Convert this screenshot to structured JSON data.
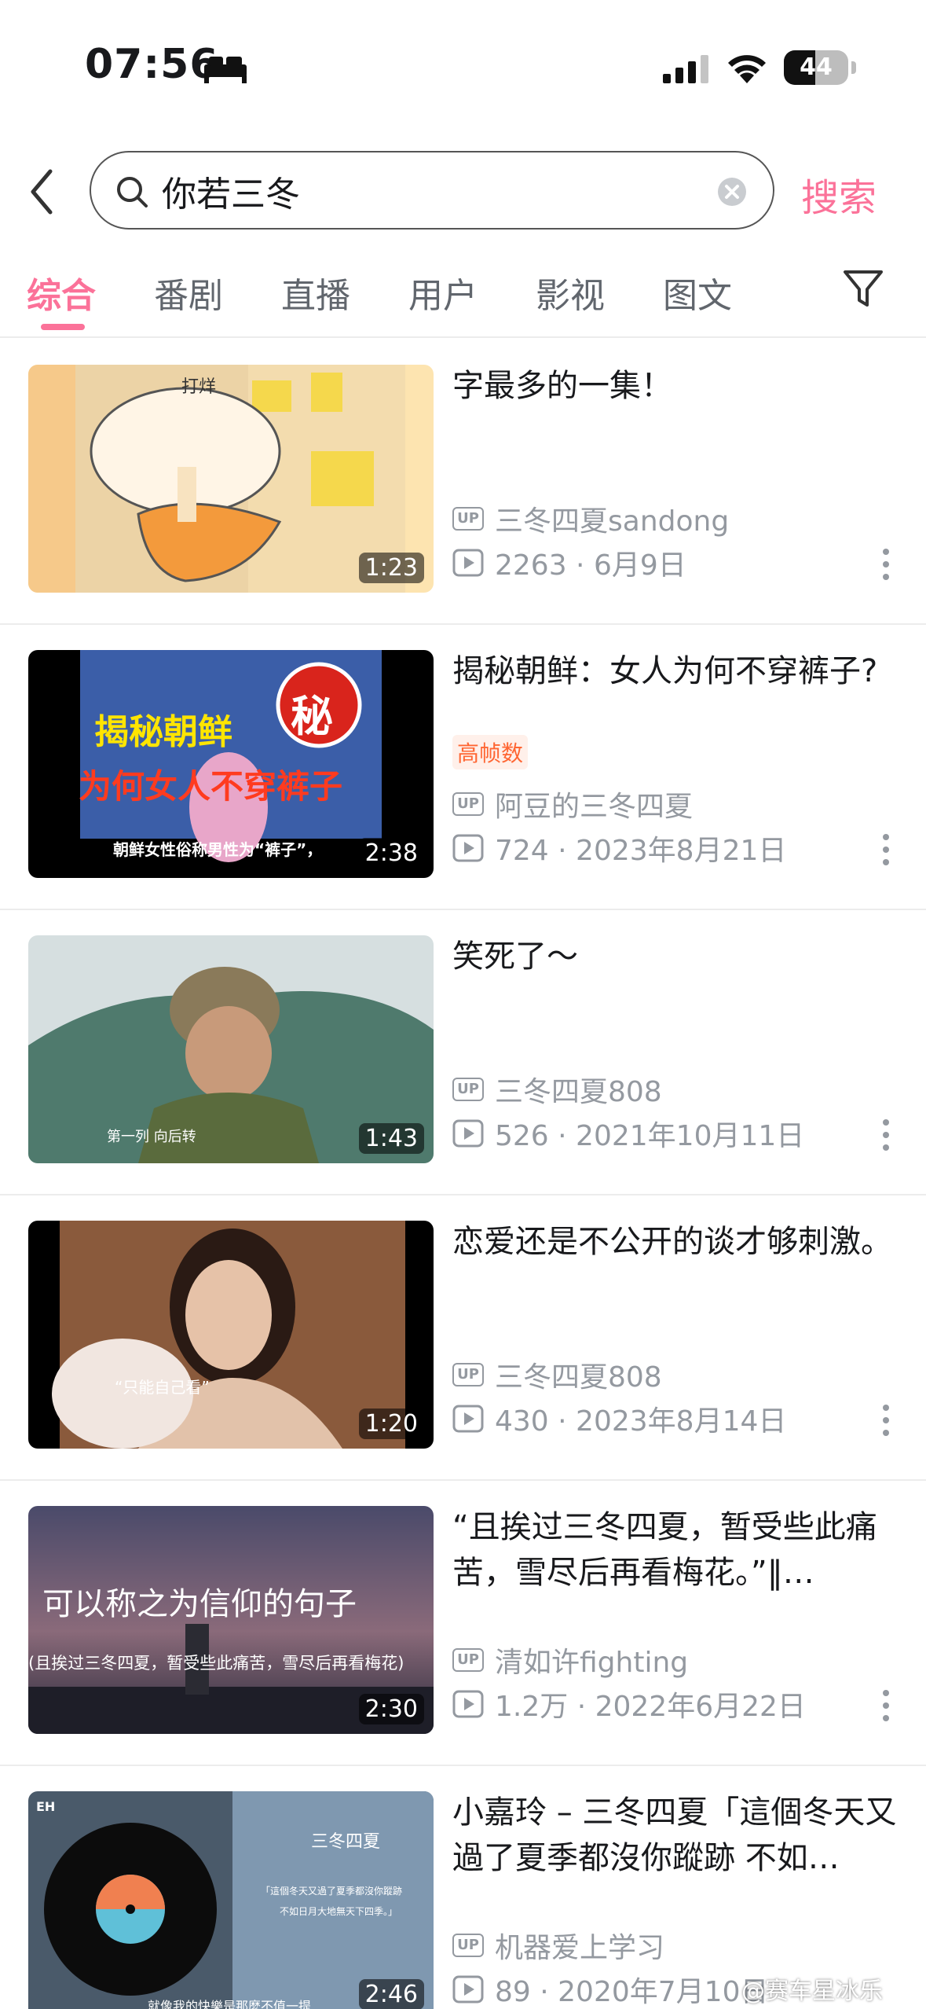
{
  "status_bar": {
    "time": "07:56",
    "battery": "44"
  },
  "search": {
    "query": "你若三冬",
    "button_label": "搜索"
  },
  "tabs": [
    {
      "label": "综合",
      "active": true
    },
    {
      "label": "番剧"
    },
    {
      "label": "直播"
    },
    {
      "label": "用户"
    },
    {
      "label": "影视"
    },
    {
      "label": "图文"
    }
  ],
  "results": [
    {
      "title": "字最多的一集！",
      "duration": "1:23",
      "uploader": "三冬四夏sandong",
      "meta": "2263 · 6月9日",
      "thumb_text": "打烊"
    },
    {
      "title": "揭秘朝鲜：女人为何不穿裤子?",
      "badge": "高帧数",
      "duration": "2:38",
      "uploader": "阿豆的三冬四夏",
      "meta": "724 · 2023年8月21日",
      "thumb_text_1": "揭秘朝鲜",
      "thumb_text_2": "为何女人不穿裤子",
      "thumb_text_3": "朝鲜女性俗称男性为“裤子”，",
      "thumb_badge": "秘"
    },
    {
      "title": "笑死了～",
      "duration": "1:43",
      "uploader": "三冬四夏808",
      "meta": "526 · 2021年10月11日",
      "thumb_text": "第一列 向后转"
    },
    {
      "title": "恋爱还是不公开的谈才够刺激。",
      "duration": "1:20",
      "uploader": "三冬四夏808",
      "meta": "430 · 2023年8月14日",
      "thumb_text": "“只能自己看”"
    },
    {
      "title": "“且挨过三冬四夏，暂受些此痛苦，雪尽后再看梅花。”‖…",
      "duration": "2:30",
      "uploader": "清如许fighting",
      "meta": "1.2万 · 2022年6月22日",
      "thumb_text_1": "可以称之为信仰的句子",
      "thumb_text_2": "(且挨过三冬四夏，暂受些此痛苦，雪尽后再看梅花)"
    },
    {
      "title": "小嘉玲 – 三冬四夏「這個冬天又過了夏季都沒你蹤跡 不如…",
      "duration": "2:46",
      "uploader": "机器爱上学习",
      "meta": "89 · 2020年7月10日",
      "thumb_text_1": "三冬四夏",
      "thumb_text_2": "「這個冬天又過了夏季都沒你蹤跡",
      "thumb_text_3": "不如日月大地無天下四季。」",
      "thumb_text_4": "就像我的快樂是那麼不值一提"
    }
  ],
  "watermark": "@赛车星冰乐"
}
